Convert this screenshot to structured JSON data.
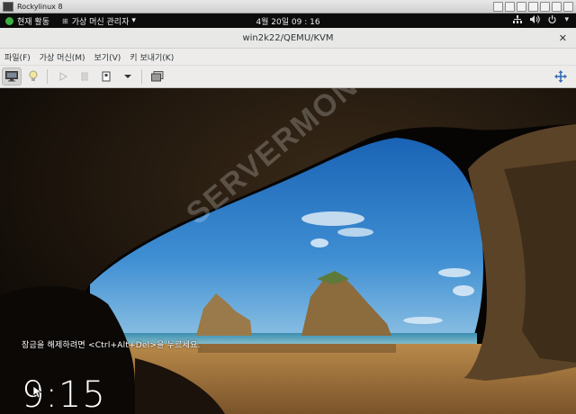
{
  "host_window": {
    "title": "Rockylinux 8"
  },
  "gnome_panel": {
    "activities": "현재 활동",
    "app_menu": "가상 머신 관리자",
    "app_menu_arrow": "▾",
    "clock": "4월 20일  09 : 16"
  },
  "vm_window": {
    "title": "win2k22/QEMU/KVM",
    "close": "✕"
  },
  "menubar": {
    "items": [
      "파일(F)",
      "가상 머신(M)",
      "보기(V)",
      "키 보내기(K)"
    ]
  },
  "guest": {
    "lock_message": "잠금을 해제하려면 <Ctrl+Alt+Del>을 누르세요.",
    "lock_time": "9:15",
    "watermark": "SERVERMON"
  }
}
